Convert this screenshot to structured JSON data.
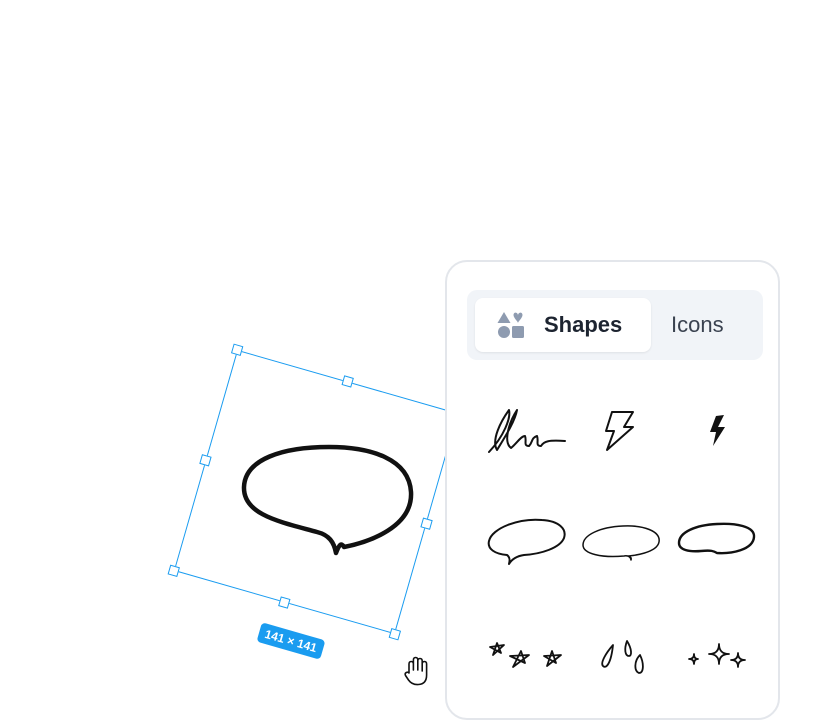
{
  "selection": {
    "size_label": "141 × 141"
  },
  "panel": {
    "tabs": [
      {
        "label": "Shapes",
        "icon": "shapes-icon",
        "selected": true
      },
      {
        "label": "Icons",
        "icon": null,
        "selected": false
      }
    ],
    "items": [
      {
        "name": "scribble-signature"
      },
      {
        "name": "lightning-bolt-outline"
      },
      {
        "name": "lightning-bolt-filled"
      },
      {
        "name": "speech-bubble-left-tail"
      },
      {
        "name": "speech-bubble-oval"
      },
      {
        "name": "speech-bubble-wide"
      },
      {
        "name": "stars-scribble"
      },
      {
        "name": "drops"
      },
      {
        "name": "sparkles"
      }
    ]
  },
  "colors": {
    "selection": "#1a9cf0",
    "panel_border": "#e3e6eb",
    "tab_bg": "#f1f4f8",
    "ink": "#111111"
  }
}
